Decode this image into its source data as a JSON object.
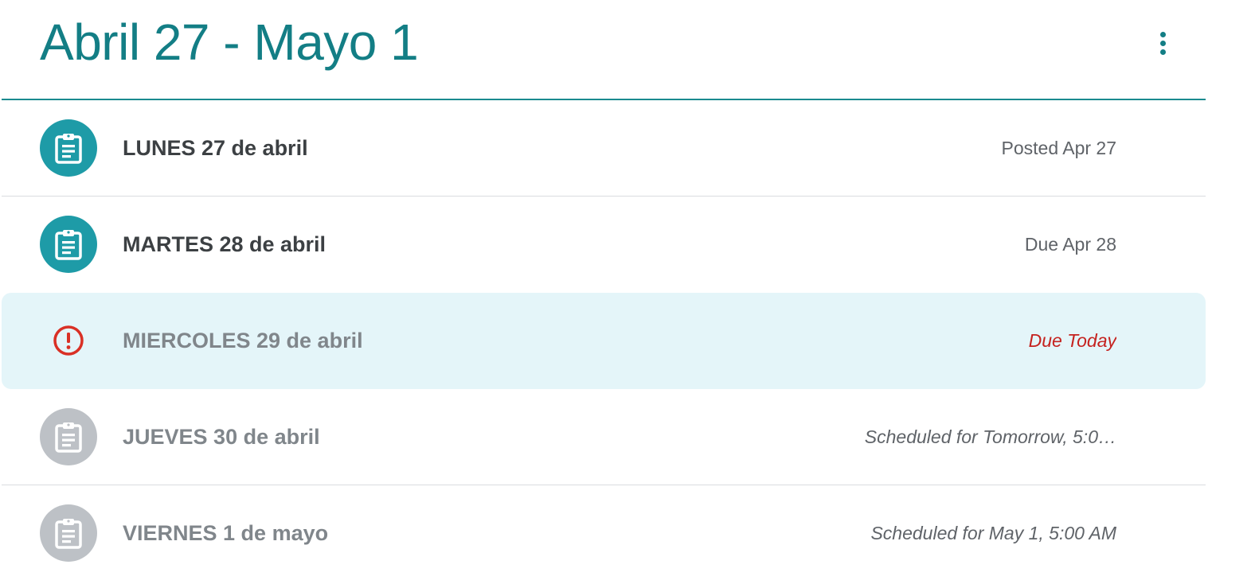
{
  "topic": {
    "title": "Abril 27 - Mayo 1",
    "menu_icon": "more-vert-icon"
  },
  "assignments": [
    {
      "title": "LUNES 27 de abril",
      "status": "Posted Apr 27",
      "icon": "assignment-icon",
      "icon_color": "#1e9ba7"
    },
    {
      "title": "MARTES 28 de abril",
      "status": "Due Apr 28",
      "icon": "assignment-icon",
      "icon_color": "#1e9ba7"
    },
    {
      "title": "MIERCOLES 29 de abril",
      "status": "Due Today",
      "icon": "alert-icon",
      "icon_color": "#d93025",
      "highlight_color": "#e4f5f9"
    },
    {
      "title": "JUEVES 30 de abril",
      "status": "Scheduled for Tomorrow, 5:0…",
      "icon": "assignment-icon",
      "icon_color": "#bdc1c6"
    },
    {
      "title": "VIERNES 1 de mayo",
      "status": "Scheduled for May 1, 5:00 AM",
      "icon": "assignment-icon",
      "icon_color": "#bdc1c6"
    }
  ],
  "colors": {
    "accent": "#137e85",
    "divider": "#dadce0",
    "due_today": "#c5221f"
  }
}
